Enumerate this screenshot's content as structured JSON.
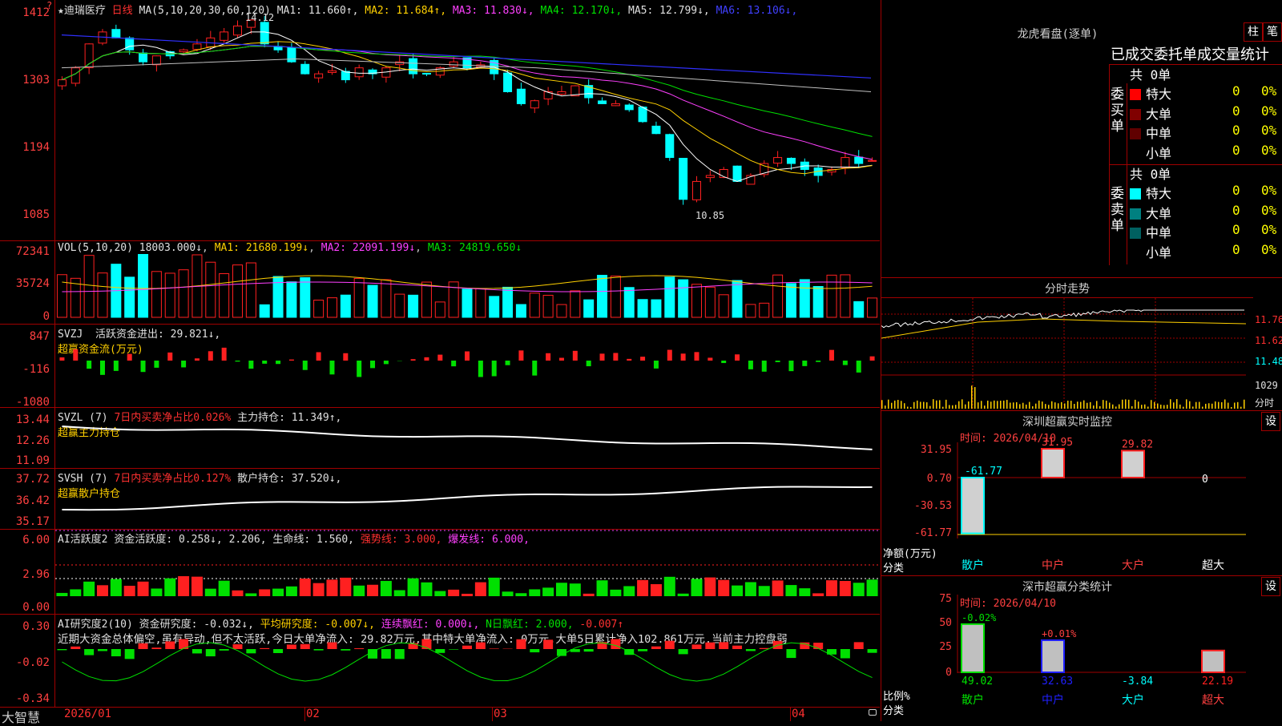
{
  "main": {
    "stock_name": "★迪瑞医疗",
    "period": "日线",
    "ma_label": "MA(5,10,20,30,60,120)",
    "ma": [
      {
        "t": "MA1: 11.660↑",
        "c": "wh"
      },
      {
        "t": "MA2: 11.684↑",
        "c": "ye"
      },
      {
        "t": "MA3: 11.830↓",
        "c": "mg"
      },
      {
        "t": "MA4: 12.170↓",
        "c": "gr"
      },
      {
        "t": "MA5: 12.799↓",
        "c": "wh"
      },
      {
        "t": "MA6: 13.106↓",
        "c": "bl"
      }
    ],
    "ticks": [
      "1412",
      "1303",
      "1194",
      "1085"
    ],
    "high_label": "14.12",
    "low_label": "10.85",
    "top_mark": "?"
  },
  "vol": {
    "label": "VOL(5,10,20)",
    "value": "18003.000↓",
    "ma1": "MA1: 21680.199↓",
    "ma2": "MA2: 22091.199↓",
    "ma3": "MA3: 24819.650↓",
    "ticks": [
      "72341",
      "35724",
      "0"
    ]
  },
  "svzj": {
    "label": "SVZJ",
    "text": "活跃资金进出: 29.821↓,",
    "sub": "超赢资金流(万元)",
    "ticks": [
      "847",
      "-116",
      "-1080"
    ]
  },
  "svzl": {
    "label": "SVZL (7)",
    "r": "7日内买卖净占比0.026%",
    "w": "主力持仓: 11.349↑,",
    "sub": "超赢主力持仓",
    "ticks": [
      "13.44",
      "12.26",
      "11.09"
    ]
  },
  "svsh": {
    "label": "SVSH (7)",
    "r": "7日内买卖净占比0.127%",
    "w": "散户持仓: 37.520↓,",
    "sub": "超赢散户持仓",
    "ticks": [
      "37.72",
      "36.42",
      "35.17"
    ]
  },
  "ai1": {
    "label": "AI活跃度2",
    "a": "资金活跃度: 0.258↓,",
    "b": "2.206,",
    "c": "生命线: 1.560,",
    "d": "强势线: 3.000,",
    "e": "爆发线: 6.000,",
    "ticks": [
      "6.00",
      "2.96",
      "0.00"
    ]
  },
  "ai2": {
    "label": "AI研究度2(10)",
    "a": "资金研究度: -0.032↓,",
    "b": "平均研究度: -0.007↓,",
    "c": "连续飘红: 0.000↓,",
    "d": "N日飘红: 2.000,",
    "e": "-0.007↑",
    "comment": "近期大资金总体偏空,虽有异动,但不太活跃,今日大单净流入: 29.82万元,其中特大单净流入: 0万元,大单5日累计净入102.861万元,当前主力控盘弱",
    "ticks": [
      "0.30",
      "-0.02",
      "-0.34"
    ]
  },
  "xaxis": {
    "brand": "大智慧",
    "labels": [
      "2026/01",
      "02",
      "03",
      "04"
    ]
  },
  "longhu": {
    "title": "龙虎看盘(逐单)",
    "btn1": "柱",
    "btn2": "笔",
    "tabs": "已成交委托单成交量统计",
    "buy_side": "委买单",
    "sell_side": "委卖单",
    "buy_total": "共 0单",
    "sell_total": "共 0单",
    "buy": [
      {
        "n": "特大",
        "c": "#ff0000",
        "v": "0",
        "p": "0%"
      },
      {
        "n": "大单",
        "c": "#800000",
        "v": "0",
        "p": "0%"
      },
      {
        "n": "中单",
        "c": "#600000",
        "v": "0",
        "p": "0%"
      },
      {
        "n": "小单",
        "c": "",
        "v": "0",
        "p": "0%"
      }
    ],
    "sell": [
      {
        "n": "特大",
        "c": "#00ffff",
        "v": "0",
        "p": "0%"
      },
      {
        "n": "大单",
        "c": "#008080",
        "v": "0",
        "p": "0%"
      },
      {
        "n": "中单",
        "c": "#006060",
        "v": "0",
        "p": "0%"
      },
      {
        "n": "小单",
        "c": "",
        "v": "0",
        "p": "0%"
      }
    ]
  },
  "fenshi": {
    "title": "分时走势",
    "ticks": [
      "11.76",
      "11.62",
      "11.48"
    ],
    "vol": "1029",
    "unit": "分时"
  },
  "sz_monitor": {
    "title": "深圳超赢实时监控",
    "btn": "设",
    "time": "时间: 2026/04/10",
    "ticks": [
      "31.95",
      "0.70",
      "-30.53",
      "-61.77"
    ],
    "ylabel": "净额(万元)",
    "xlabel": "分类",
    "cats": [
      "散户",
      "中户",
      "大户",
      "超大"
    ],
    "values": [
      "-61.77",
      "31.95",
      "29.82",
      "0"
    ]
  },
  "sz_class": {
    "title": "深市超赢分类统计",
    "btn": "设",
    "time": "时间: 2026/04/10",
    "ticks": [
      "75",
      "50",
      "25",
      "0"
    ],
    "ylabel": "比例%",
    "xlabel": "分类",
    "cats": [
      "散户",
      "中户",
      "大户",
      "超大"
    ],
    "top": [
      "-0.02%",
      "+0.01%",
      "",
      ""
    ],
    "bottom": [
      "49.02",
      "32.63",
      "-3.84",
      "22.19"
    ]
  }
}
